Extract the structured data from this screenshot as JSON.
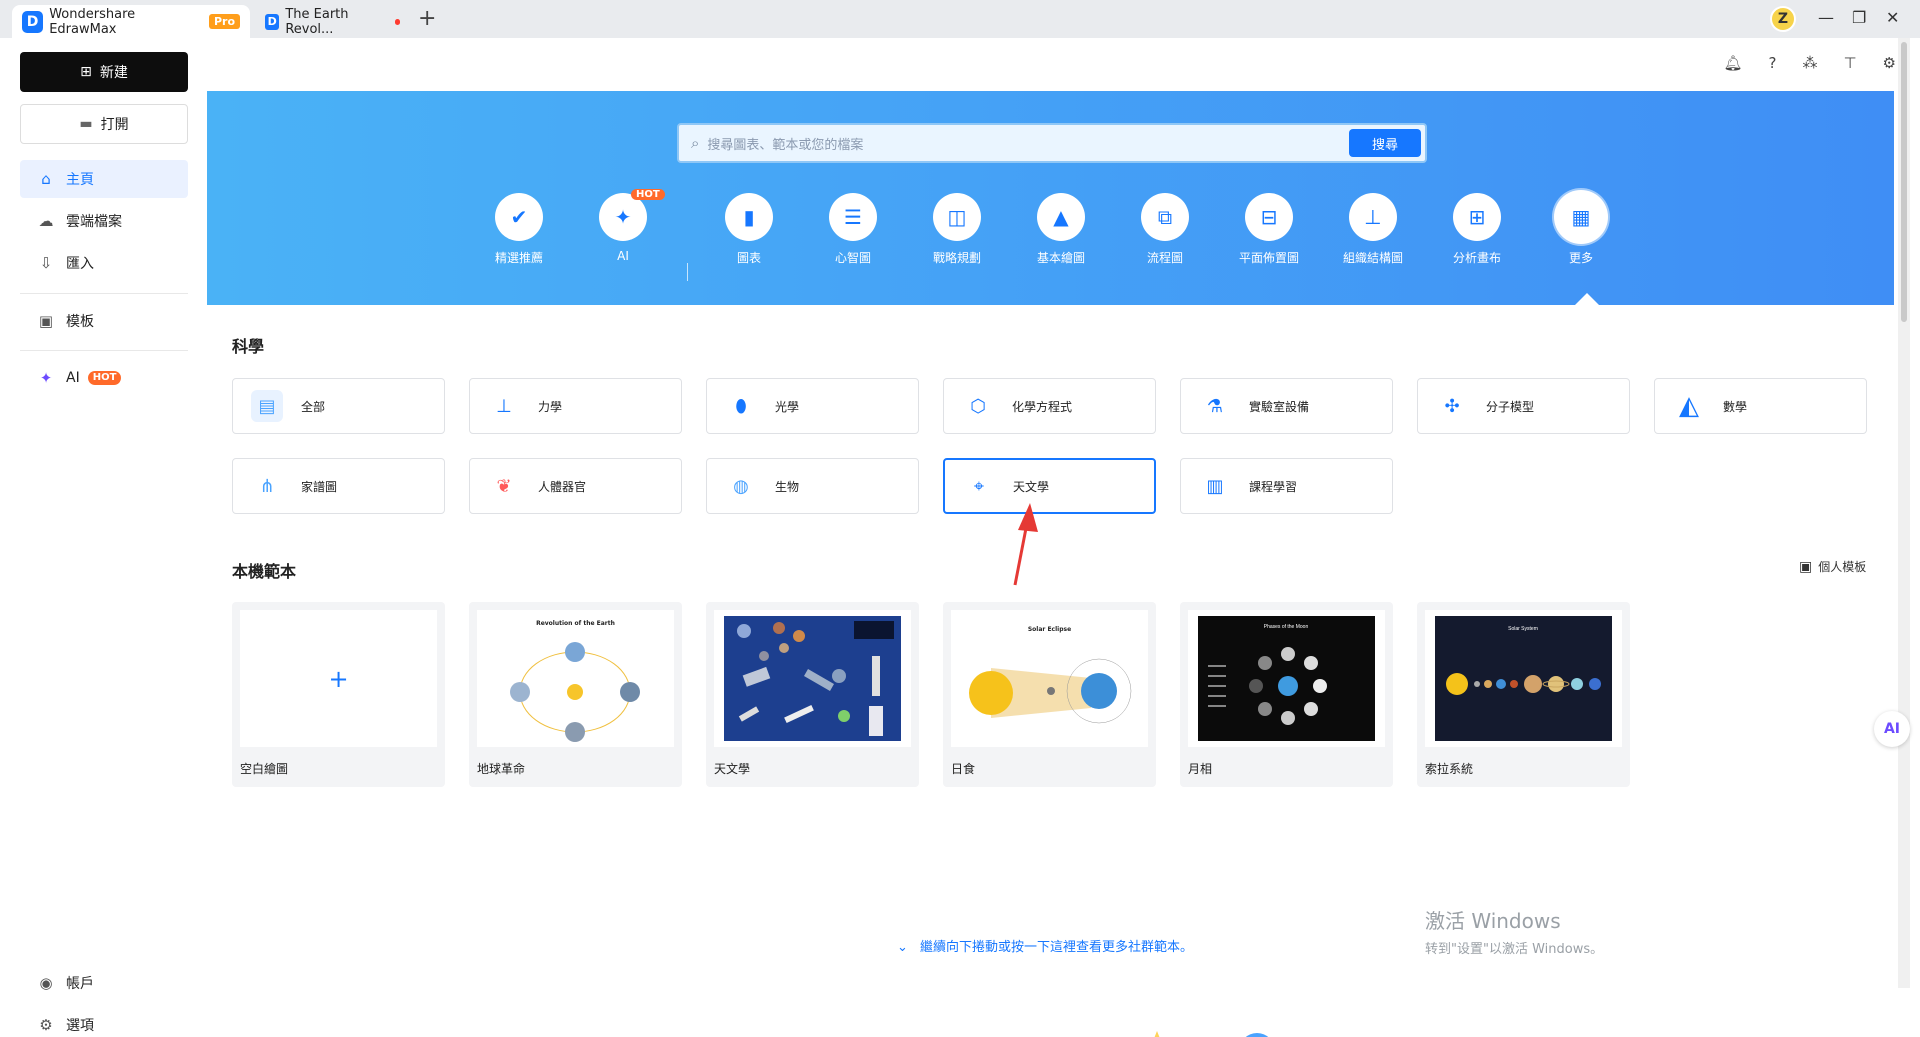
{
  "titlebar": {
    "tabs": [
      {
        "title": "Wondershare EdrawMax",
        "badge": "Pro"
      },
      {
        "title": "The Earth Revol..."
      }
    ],
    "avatar_letter": "Z"
  },
  "sidebar": {
    "new_label": "新建",
    "open_label": "打開",
    "items": [
      {
        "label": "主頁"
      },
      {
        "label": "雲端檔案"
      },
      {
        "label": "匯入"
      },
      {
        "label": "模板"
      },
      {
        "label": "AI",
        "badge": "HOT"
      }
    ],
    "bottom": [
      {
        "label": "帳戶"
      },
      {
        "label": "選項"
      }
    ]
  },
  "search": {
    "placeholder": "搜尋圖表、範本或您的檔案",
    "button": "搜尋"
  },
  "categories": [
    {
      "label": "精選推薦"
    },
    {
      "label": "AI",
      "badge": "HOT"
    },
    {
      "label": "圖表"
    },
    {
      "label": "心智圖"
    },
    {
      "label": "戰略規劃"
    },
    {
      "label": "基本繪圖"
    },
    {
      "label": "流程圖"
    },
    {
      "label": "平面佈置圖"
    },
    {
      "label": "組織結構圖"
    },
    {
      "label": "分析畫布"
    },
    {
      "label": "更多"
    }
  ],
  "science": {
    "title": "科學",
    "items": [
      {
        "label": "全部"
      },
      {
        "label": "力學"
      },
      {
        "label": "光學"
      },
      {
        "label": "化學方程式"
      },
      {
        "label": "實驗室設備"
      },
      {
        "label": "分子模型"
      },
      {
        "label": "數學"
      },
      {
        "label": "家譜圖"
      },
      {
        "label": "人體器官"
      },
      {
        "label": "生物"
      },
      {
        "label": "天文學"
      },
      {
        "label": "課程學習"
      }
    ]
  },
  "local": {
    "title": "本機範本",
    "personal": "個人模板",
    "cards": [
      {
        "caption": "空白繪圖"
      },
      {
        "caption": "地球革命",
        "thumb_title": "Revolution of the Earth"
      },
      {
        "caption": "天文學"
      },
      {
        "caption": "日食",
        "thumb_title": "Solar Eclipse"
      },
      {
        "caption": "月相",
        "thumb_title": "Phases of the Moon"
      },
      {
        "caption": "索拉系統",
        "thumb_title": "Solar System"
      }
    ]
  },
  "scroll_more": "繼續向下捲動或按一下這裡查看更多社群範本。",
  "watermark": {
    "line1": "激活 Windows",
    "line2": "转到\"设置\"以激活 Windows。"
  },
  "colors": {
    "accent": "#1677ff",
    "hot": "#ff6a2a",
    "pro": "#ff9e1b"
  }
}
